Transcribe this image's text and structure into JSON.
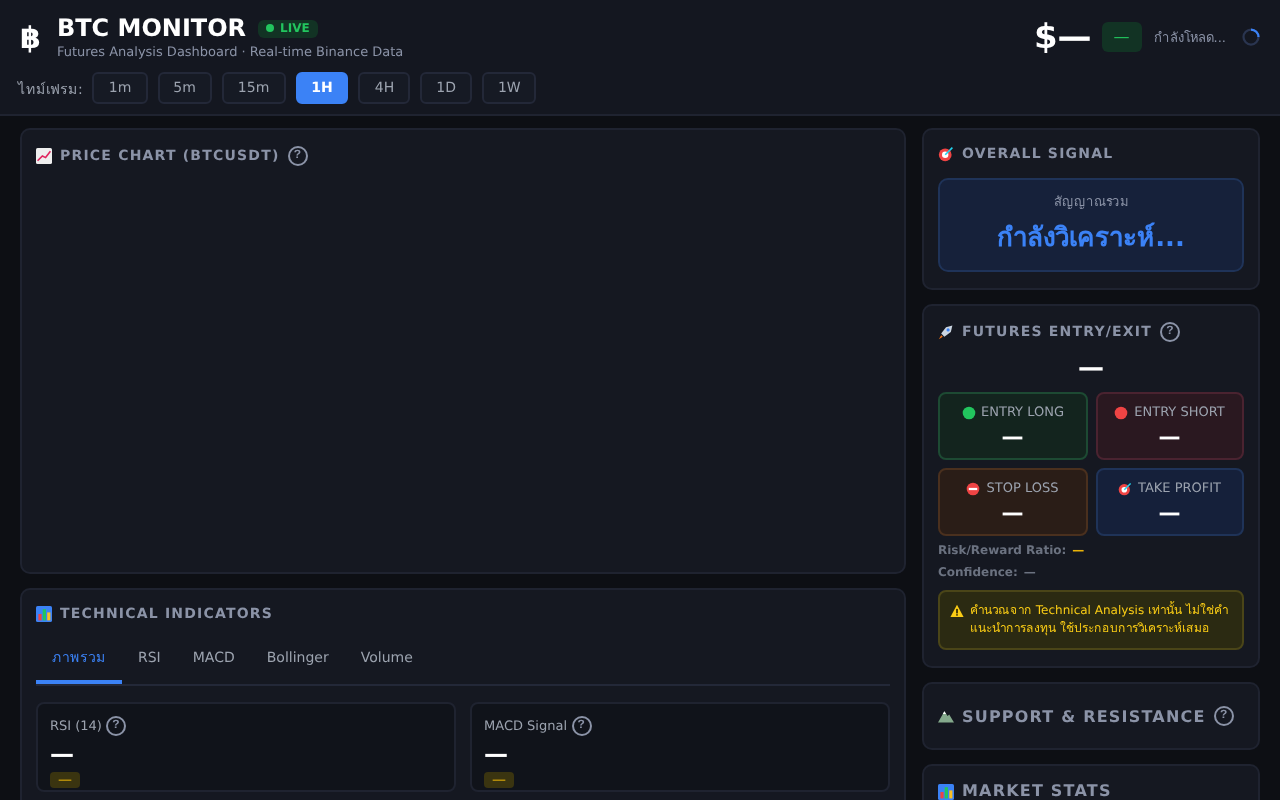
{
  "header": {
    "logo": "฿",
    "title": "BTC MONITOR",
    "live_badge": "LIVE",
    "subtitle": "Futures Analysis Dashboard · Real-time Binance Data",
    "price": "$—",
    "change": "—",
    "status": "กำลังโหลด..."
  },
  "timeframe": {
    "label": "ไทม์เฟรม:",
    "options": [
      {
        "label": "1m",
        "selected": false
      },
      {
        "label": "5m",
        "selected": false
      },
      {
        "label": "15m",
        "selected": false
      },
      {
        "label": "1H",
        "selected": true
      },
      {
        "label": "4H",
        "selected": false
      },
      {
        "label": "1D",
        "selected": false
      },
      {
        "label": "1W",
        "selected": false
      }
    ]
  },
  "price_chart": {
    "title": "PRICE CHART (BTCUSDT)",
    "help": "?"
  },
  "indicators": {
    "title": "TECHNICAL INDICATORS",
    "tabs": [
      {
        "label": "ภาพรวม",
        "selected": true
      },
      {
        "label": "RSI",
        "selected": false
      },
      {
        "label": "MACD",
        "selected": false
      },
      {
        "label": "Bollinger",
        "selected": false
      },
      {
        "label": "Volume",
        "selected": false
      }
    ],
    "cards": [
      {
        "label": "RSI (14)",
        "help": "?",
        "value": "—",
        "badge": "—"
      },
      {
        "label": "MACD Signal",
        "help": "?",
        "value": "—",
        "badge": "—"
      }
    ]
  },
  "overall_signal": {
    "title": "OVERALL SIGNAL",
    "caption": "สัญญาณรวม",
    "value": "กำลังวิเคราะห์..."
  },
  "futures": {
    "title": "FUTURES ENTRY/EXIT",
    "help": "?",
    "direction": "—",
    "boxes": [
      {
        "kind": "long",
        "label": "ENTRY LONG",
        "value": "—"
      },
      {
        "kind": "short",
        "label": "ENTRY SHORT",
        "value": "—"
      },
      {
        "kind": "stop",
        "label": "STOP LOSS",
        "value": "—"
      },
      {
        "kind": "target",
        "label": "TAKE PROFIT",
        "value": "—"
      }
    ],
    "risk_reward": {
      "label": "Risk/Reward Ratio:",
      "value": "—"
    },
    "confidence": {
      "label": "Confidence:",
      "value": "—"
    },
    "warning": "คำนวณจาก Technical Analysis เท่านั้น ไม่ใช่คำแนะนำการลงทุน ใช้ประกอบการวิเคราะห์เสมอ"
  },
  "support_resistance": {
    "title": "SUPPORT & RESISTANCE",
    "help": "?"
  },
  "market_stats": {
    "title": "MARKET STATS"
  }
}
